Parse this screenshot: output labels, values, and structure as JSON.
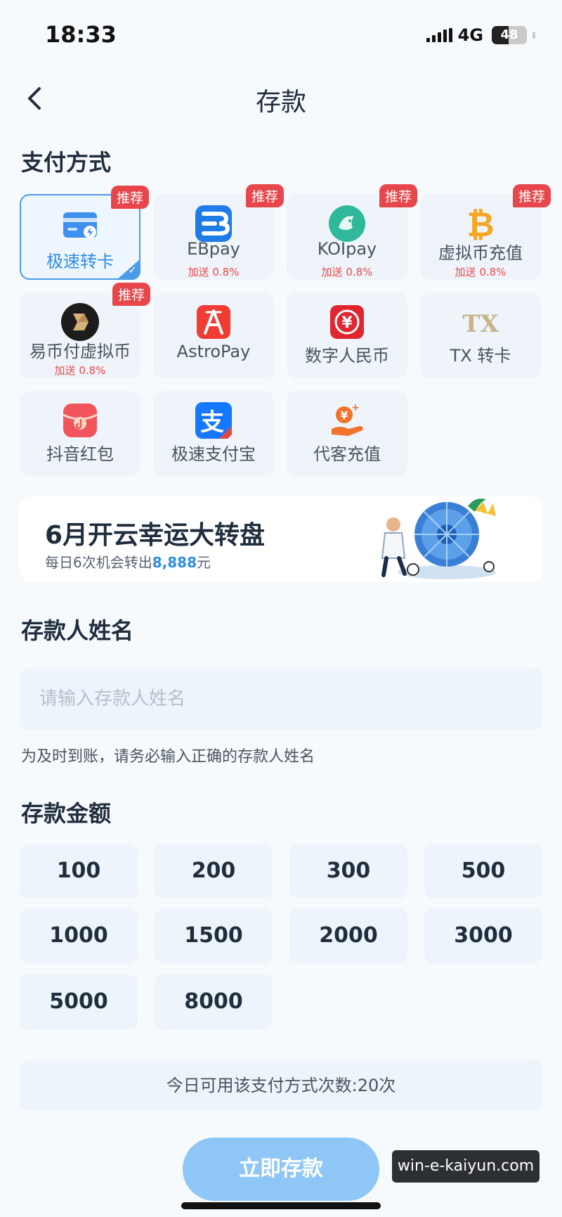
{
  "status": {
    "time": "18:33",
    "network": "4G",
    "battery": "48"
  },
  "nav": {
    "title": "存款"
  },
  "payment": {
    "section_title": "支付方式",
    "methods": [
      {
        "label": "极速转卡",
        "badge": "推荐",
        "bonus": "",
        "selected": true,
        "icon": "card-lightning-icon"
      },
      {
        "label": "EBpay",
        "badge": "推荐",
        "bonus": "加送 0.8%",
        "icon": "ebpay-icon"
      },
      {
        "label": "KOIpay",
        "badge": "推荐",
        "bonus": "加送 0.8%",
        "icon": "koipay-fish-icon"
      },
      {
        "label": "虚拟币充值",
        "badge": "推荐",
        "bonus": "加送 0.8%",
        "icon": "bitcoin-icon"
      },
      {
        "label": "易币付虚拟币",
        "badge": "推荐",
        "bonus": "加送 0.8%",
        "icon": "yibifu-icon"
      },
      {
        "label": "AstroPay",
        "badge": "",
        "bonus": "",
        "icon": "astropay-icon"
      },
      {
        "label": "数字人民币",
        "badge": "",
        "bonus": "",
        "icon": "digital-rmb-icon"
      },
      {
        "label": "TX 转卡",
        "badge": "",
        "bonus": "",
        "icon": "tx-logo-icon"
      },
      {
        "label": "抖音红包",
        "badge": "",
        "bonus": "",
        "icon": "douyin-redpacket-icon"
      },
      {
        "label": "极速支付宝",
        "badge": "",
        "bonus": "",
        "icon": "alipay-icon"
      },
      {
        "label": "代客充值",
        "badge": "",
        "bonus": "",
        "icon": "agent-topup-icon"
      }
    ]
  },
  "promo": {
    "title": "6月开云幸运大转盘",
    "sub_prefix": "每日6次机会转出",
    "sub_amount": "8,888",
    "sub_suffix": "元"
  },
  "depositor": {
    "section_title": "存款人姓名",
    "placeholder": "请输入存款人姓名",
    "value": "",
    "hint": "为及时到账，请务必输入正确的存款人姓名"
  },
  "amount": {
    "section_title": "存款金额",
    "options": [
      "100",
      "200",
      "300",
      "500",
      "1000",
      "1500",
      "2000",
      "3000",
      "5000",
      "8000"
    ]
  },
  "usage_text": "今日可用该支付方式次数:20次",
  "submit_label": "立即存款",
  "watermark": "win-e-kaiyun.com",
  "colors": {
    "accent": "#2f8de4",
    "badge": "#e7474b",
    "card_bg": "#eef4fa",
    "submit": "#8ec7f5"
  }
}
